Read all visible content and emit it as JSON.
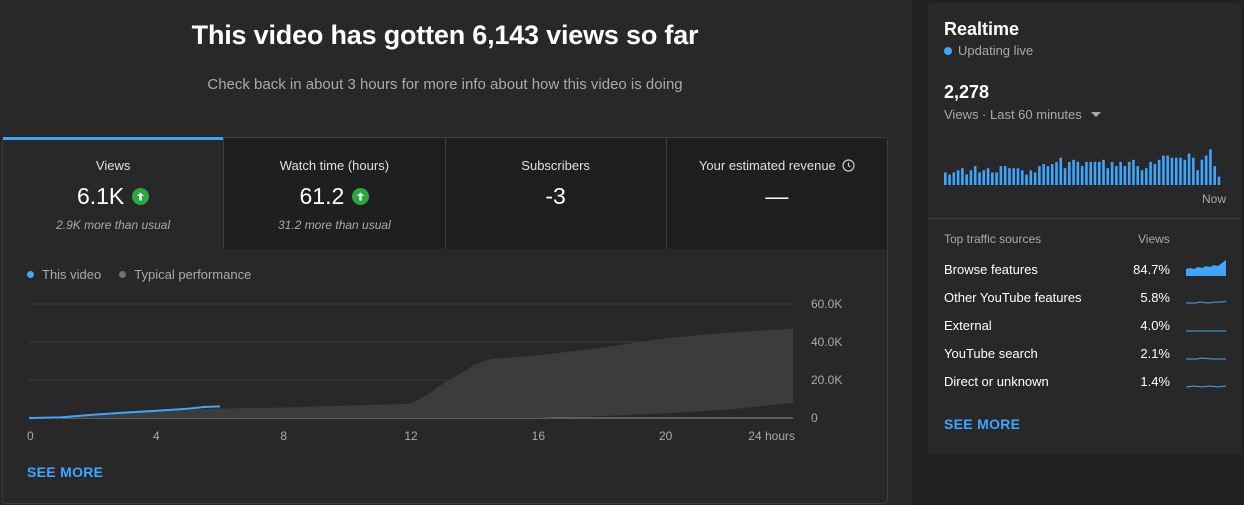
{
  "headline": "This video has gotten 6,143 views so far",
  "subline": "Check back in about 3 hours for more info about how this video is doing",
  "tabs": [
    {
      "title": "Views",
      "value": "6.1K",
      "note": "2.9K more than usual",
      "trend": "up"
    },
    {
      "title": "Watch time (hours)",
      "value": "61.2",
      "note": "31.2 more than usual",
      "trend": "up"
    },
    {
      "title": "Subscribers",
      "value": "-3",
      "note": "",
      "trend": ""
    },
    {
      "title": "Your estimated revenue",
      "value": "—",
      "note": "",
      "trend": ""
    }
  ],
  "legend": {
    "this_video": "This video",
    "typical": "Typical performance"
  },
  "chart_data": {
    "type": "area",
    "x_ticks": [
      "0",
      "4",
      "8",
      "12",
      "16",
      "20",
      "24 hours"
    ],
    "y_ticks": [
      "0",
      "20.0K",
      "40.0K",
      "60.0K"
    ],
    "ylim": [
      0,
      60000
    ],
    "xlim": [
      0,
      24
    ],
    "series": [
      {
        "name": "This video",
        "color": "#3ea6ff",
        "x": [
          0,
          1,
          2,
          3,
          4,
          5,
          5.5,
          6
        ],
        "y": [
          0,
          300,
          1700,
          2800,
          3800,
          4900,
          5800,
          6143
        ]
      },
      {
        "name": "Typical performance",
        "type": "band",
        "color": "#3c3c3c",
        "x": [
          0,
          1,
          2,
          3,
          4,
          5,
          6,
          8,
          10,
          12,
          12.5,
          13,
          14,
          14.5,
          16,
          18,
          20,
          22,
          24
        ],
        "upper": [
          0,
          500,
          1500,
          2500,
          3500,
          4500,
          5000,
          5500,
          6500,
          7500,
          12000,
          18000,
          28000,
          31000,
          33000,
          37000,
          42000,
          45000,
          47000
        ],
        "lower": [
          0,
          0,
          0,
          0,
          0,
          0,
          0,
          0,
          0,
          0,
          0,
          0,
          0,
          0,
          0,
          1000,
          2500,
          4500,
          8000
        ]
      }
    ],
    "grid": true
  },
  "see_more_main": "SEE MORE",
  "realtime": {
    "title": "Realtime",
    "status": "Updating live",
    "count": "2,278",
    "period": "Views · Last 60 minutes",
    "now_label": "Now",
    "bar_values": [
      0.3,
      0.25,
      0.3,
      0.35,
      0.4,
      0.25,
      0.35,
      0.45,
      0.3,
      0.35,
      0.4,
      0.3,
      0.3,
      0.45,
      0.45,
      0.4,
      0.4,
      0.4,
      0.35,
      0.25,
      0.35,
      0.3,
      0.45,
      0.5,
      0.45,
      0.5,
      0.55,
      0.65,
      0.4,
      0.55,
      0.6,
      0.55,
      0.45,
      0.55,
      0.55,
      0.55,
      0.55,
      0.6,
      0.4,
      0.55,
      0.45,
      0.55,
      0.45,
      0.55,
      0.6,
      0.45,
      0.35,
      0.4,
      0.55,
      0.5,
      0.6,
      0.7,
      0.7,
      0.65,
      0.65,
      0.65,
      0.6,
      0.75,
      0.65,
      0.35,
      0.6,
      0.7,
      0.85,
      0.45,
      0.2
    ]
  },
  "traffic": {
    "header_left": "Top traffic sources",
    "header_right": "Views",
    "rows": [
      {
        "name": "Browse features",
        "pct": "84.7%"
      },
      {
        "name": "Other YouTube features",
        "pct": "5.8%"
      },
      {
        "name": "External",
        "pct": "4.0%"
      },
      {
        "name": "YouTube search",
        "pct": "2.1%"
      },
      {
        "name": "Direct or unknown",
        "pct": "1.4%"
      }
    ]
  },
  "see_more_side": "SEE MORE",
  "colors": {
    "accent": "#3ea6ff",
    "up": "#2ba640",
    "live_dot": "#3ea6ff"
  }
}
